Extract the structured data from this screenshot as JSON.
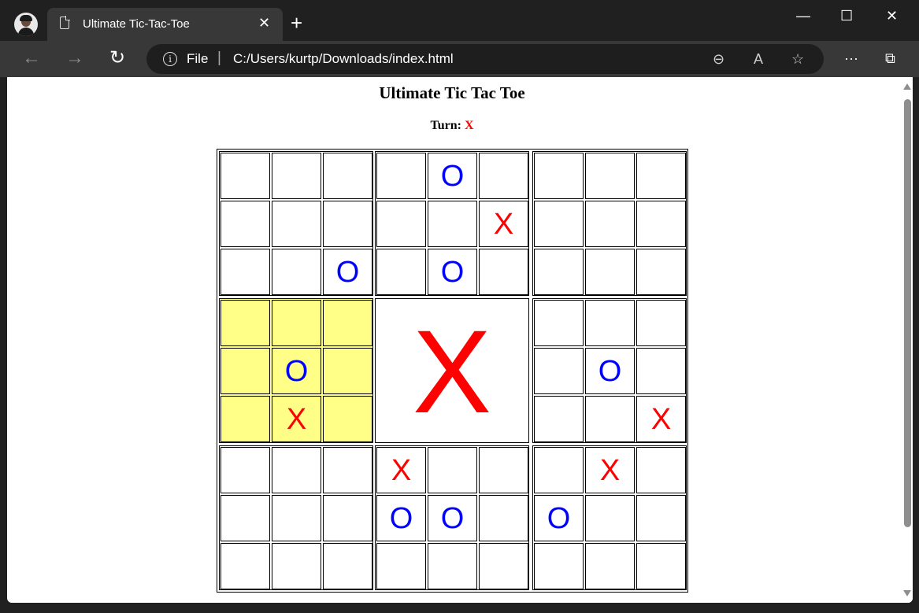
{
  "browser": {
    "tab_title": "Ultimate Tic-Tac-Toe",
    "tab_close": "✕",
    "new_tab": "+",
    "minimize": "—",
    "maximize": "☐",
    "close_window": "✕",
    "back": "←",
    "forward": "→",
    "reload": "↻",
    "info": "i",
    "scheme": "File",
    "separator": "|",
    "url": "C:/Users/kurtp/Downloads/index.html",
    "zoom_icon": "⊖",
    "read_aloud_icon": "A",
    "favorite_icon": "☆",
    "more_icon": "···",
    "sidebar_icon": "⧉"
  },
  "page": {
    "title": "Ultimate Tic Tac Toe",
    "turn_label": "Turn:",
    "turn_value": "X"
  },
  "game": {
    "active_board": 3,
    "boards": [
      {
        "winner": "",
        "cells": [
          "",
          "",
          "",
          "",
          "",
          "",
          "",
          "",
          "O"
        ]
      },
      {
        "winner": "",
        "cells": [
          "",
          "O",
          "",
          "",
          "",
          "X",
          "",
          "O",
          ""
        ]
      },
      {
        "winner": "",
        "cells": [
          "",
          "",
          "",
          "",
          "",
          "",
          "",
          "",
          ""
        ]
      },
      {
        "winner": "",
        "cells": [
          "",
          "",
          "",
          "",
          "O",
          "",
          "",
          "X",
          ""
        ]
      },
      {
        "winner": "X",
        "cells": [
          "",
          "",
          "",
          "",
          "",
          "",
          "",
          "",
          ""
        ]
      },
      {
        "winner": "",
        "cells": [
          "",
          "",
          "",
          "",
          "O",
          "",
          "",
          "",
          "X"
        ]
      },
      {
        "winner": "",
        "cells": [
          "",
          "",
          "",
          "",
          "",
          "",
          "",
          "",
          ""
        ]
      },
      {
        "winner": "",
        "cells": [
          "X",
          "",
          "",
          "O",
          "O",
          "",
          "",
          "",
          ""
        ]
      },
      {
        "winner": "",
        "cells": [
          "",
          "X",
          "",
          "O",
          "",
          "",
          "",
          "",
          ""
        ]
      }
    ]
  },
  "colors": {
    "x_mark": "#ff0000",
    "o_mark": "#0000ff",
    "active_board": "#ffff88"
  }
}
